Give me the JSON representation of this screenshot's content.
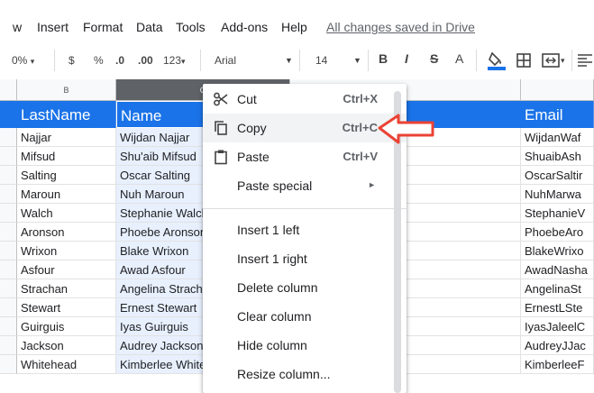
{
  "menubar": {
    "items": [
      "w",
      "Insert",
      "Format",
      "Data",
      "Tools",
      "Add-ons",
      "Help"
    ],
    "saved_status": "All changes saved in Drive"
  },
  "toolbar": {
    "zoom": "0%",
    "currency": "$",
    "percent": "%",
    "decrease_decimal": ".0",
    "increase_decimal": ".00",
    "more_formats": "123",
    "font": "Arial",
    "font_size": "14",
    "bold": "B",
    "italic": "I",
    "strike": "S",
    "text_color": "A"
  },
  "sheet": {
    "column_letters": [
      "B",
      "C"
    ],
    "headers": [
      "LastName",
      "Name",
      "Email"
    ],
    "rows": [
      {
        "last": "Najjar",
        "name": "Wijdan Najjar",
        "email": "WijdanWaf"
      },
      {
        "last": "Mifsud",
        "name": "Shu'aib Mifsud",
        "email": "ShuaibAsh"
      },
      {
        "last": "Salting",
        "name": "Oscar Salting",
        "email": "OscarSaltir"
      },
      {
        "last": "Maroun",
        "name": "Nuh Maroun",
        "email": "NuhMarwa"
      },
      {
        "last": "Walch",
        "name": "Stephanie Walch",
        "email": "StephanieV"
      },
      {
        "last": "Aronson",
        "name": "Phoebe Aronson",
        "email": "PhoebeAro"
      },
      {
        "last": "Wrixon",
        "name": "Blake Wrixon",
        "email": "BlakeWrixo"
      },
      {
        "last": "Asfour",
        "name": "Awad Asfour",
        "email": "AwadNasha"
      },
      {
        "last": "Strachan",
        "name": "Angelina Strachan",
        "email": "AngelinaSt"
      },
      {
        "last": "Stewart",
        "name": "Ernest Stewart",
        "email": "ErnestLSte"
      },
      {
        "last": "Guirguis",
        "name": "Iyas Guirguis",
        "email": "IyasJaleelC"
      },
      {
        "last": "Jackson",
        "name": "Audrey Jackson",
        "email": "AudreyJJac"
      },
      {
        "last": "Whitehead",
        "name": "Kimberlee Whitehead",
        "email": "KimberleeF"
      }
    ]
  },
  "context_menu": {
    "items": [
      {
        "label": "Cut",
        "shortcut": "Ctrl+X",
        "icon": "scissors-icon"
      },
      {
        "label": "Copy",
        "shortcut": "Ctrl+C",
        "icon": "copy-icon"
      },
      {
        "label": "Paste",
        "shortcut": "Ctrl+V",
        "icon": "clipboard-icon"
      },
      {
        "label": "Paste special",
        "shortcut": "",
        "icon": ""
      },
      {
        "label": "Insert 1 left",
        "shortcut": "",
        "icon": ""
      },
      {
        "label": "Insert 1 right",
        "shortcut": "",
        "icon": ""
      },
      {
        "label": "Delete column",
        "shortcut": "",
        "icon": ""
      },
      {
        "label": "Clear column",
        "shortcut": "",
        "icon": ""
      },
      {
        "label": "Hide column",
        "shortcut": "",
        "icon": ""
      },
      {
        "label": "Resize column...",
        "shortcut": "",
        "icon": ""
      }
    ],
    "highlighted_index": 1
  },
  "colors": {
    "header_blue": "#1a73e8",
    "selection": "#e8f0fe",
    "pointer": "#ea4335"
  }
}
